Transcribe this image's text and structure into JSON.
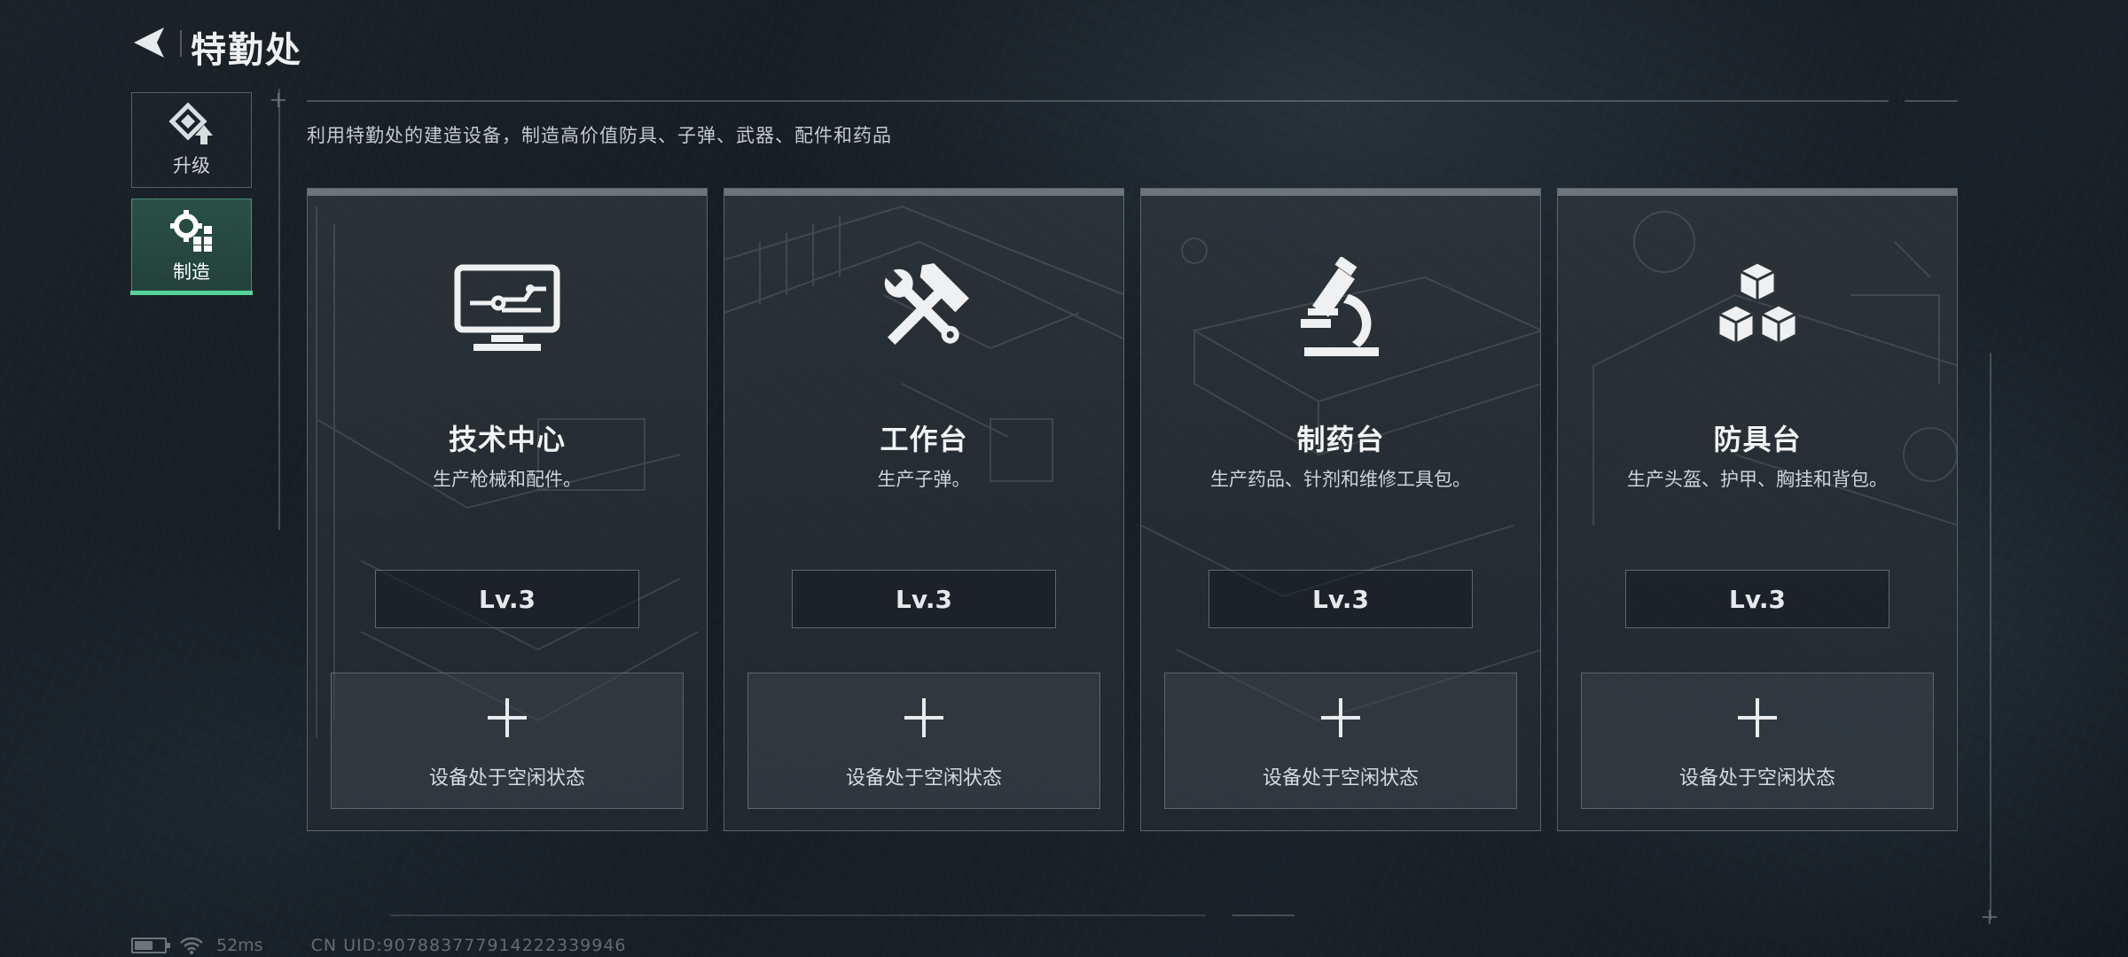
{
  "header": {
    "title": "特勤处",
    "back_icon": "back-arrow-icon"
  },
  "sidebar": {
    "items": [
      {
        "label": "升级",
        "icon": "upgrade-icon",
        "active": false
      },
      {
        "label": "制造",
        "icon": "gear-manufacture-icon",
        "active": true
      }
    ]
  },
  "main": {
    "subtitle": "利用特勤处的建造设备，制造高价值防具、子弹、武器、配件和药品",
    "cards": [
      {
        "name": "技术中心",
        "desc": "生产枪械和配件。",
        "level": "Lv.3",
        "status": "设备处于空闲状态",
        "icon": "computer-board-icon"
      },
      {
        "name": "工作台",
        "desc": "生产子弹。",
        "level": "Lv.3",
        "status": "设备处于空闲状态",
        "icon": "hammer-wrench-icon"
      },
      {
        "name": "制药台",
        "desc": "生产药品、针剂和维修工具包。",
        "level": "Lv.3",
        "status": "设备处于空闲状态",
        "icon": "microscope-icon"
      },
      {
        "name": "防具台",
        "desc": "生产头盔、护甲、胸挂和背包。",
        "level": "Lv.3",
        "status": "设备处于空闲状态",
        "icon": "boxes-icon"
      }
    ]
  },
  "footer": {
    "ping": "52ms",
    "uid": "CN UID:907883777914222339946"
  }
}
